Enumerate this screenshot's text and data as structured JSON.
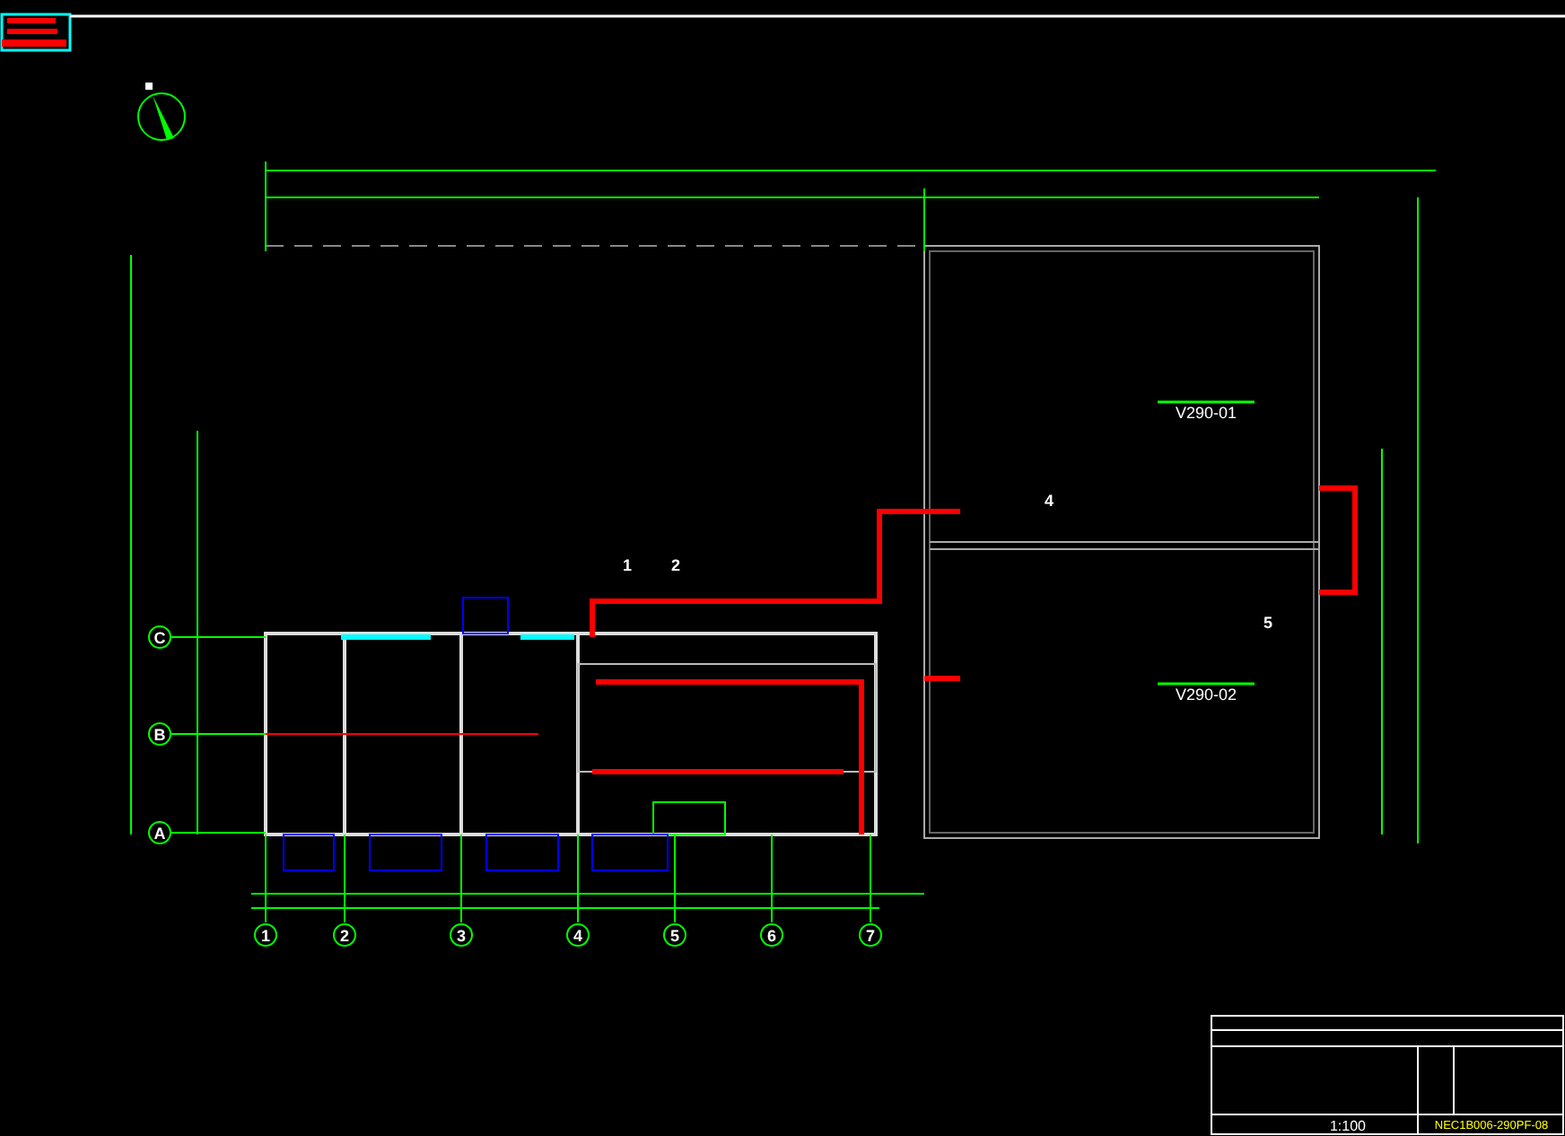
{
  "plan_areas": [
    {
      "label": "V290-01"
    },
    {
      "label": "V290-02"
    }
  ],
  "grid_columns": [
    {
      "label": "1"
    },
    {
      "label": "2"
    },
    {
      "label": "3"
    },
    {
      "label": "4"
    },
    {
      "label": "5"
    },
    {
      "label": "6"
    },
    {
      "label": "7"
    }
  ],
  "grid_rows": [
    {
      "label": "C"
    },
    {
      "label": "B"
    },
    {
      "label": "A"
    }
  ],
  "section_marks": [
    {
      "label": "1"
    },
    {
      "label": "2"
    },
    {
      "label": "4"
    },
    {
      "label": "5"
    }
  ],
  "title_block": {
    "scale": "1:100",
    "drawing_number": "NEC1B006-290PF-08"
  }
}
